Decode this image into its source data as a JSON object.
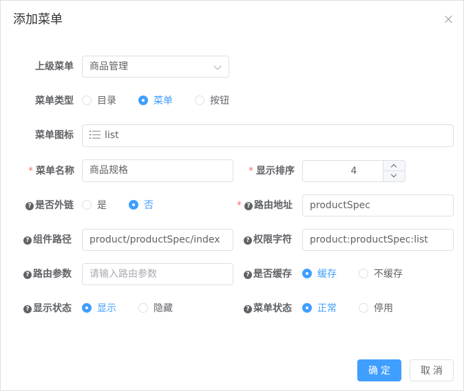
{
  "dialog": {
    "title": "添加菜单",
    "close_icon": "close-icon"
  },
  "form": {
    "parent_menu": {
      "label": "上级菜单",
      "value": "商品管理"
    },
    "menu_type": {
      "label": "菜单类型",
      "options": [
        "目录",
        "菜单",
        "按钮"
      ],
      "selected": "菜单"
    },
    "menu_icon": {
      "label": "菜单图标",
      "icon": "list-icon",
      "value": "list"
    },
    "menu_name": {
      "label": "菜单名称",
      "required": "*",
      "value": "商品规格"
    },
    "sort_order": {
      "label": "显示排序",
      "required": "*",
      "value": "4"
    },
    "is_external": {
      "label": "是否外链",
      "help": "?",
      "options": [
        "是",
        "否"
      ],
      "selected": "否"
    },
    "route_path": {
      "label": "路由地址",
      "required": "*",
      "help": "?",
      "value": "productSpec"
    },
    "component_path": {
      "label": "组件路径",
      "help": "?",
      "value": "product/productSpec/index"
    },
    "permission": {
      "label": "权限字符",
      "help": "?",
      "value": "product:productSpec:list"
    },
    "route_params": {
      "label": "路由参数",
      "help": "?",
      "value": "",
      "placeholder": "请输入路由参数"
    },
    "is_cache": {
      "label": "是否缓存",
      "help": "?",
      "options": [
        "缓存",
        "不缓存"
      ],
      "selected": "缓存"
    },
    "visible": {
      "label": "显示状态",
      "help": "?",
      "options": [
        "显示",
        "隐藏"
      ],
      "selected": "显示"
    },
    "status": {
      "label": "菜单状态",
      "help": "?",
      "options": [
        "正常",
        "停用"
      ],
      "selected": "正常"
    }
  },
  "footer": {
    "confirm_label": "确定",
    "cancel_label": "取消"
  },
  "colors": {
    "primary": "#409eff",
    "required": "#f56c6c",
    "border": "#dcdfe6"
  }
}
